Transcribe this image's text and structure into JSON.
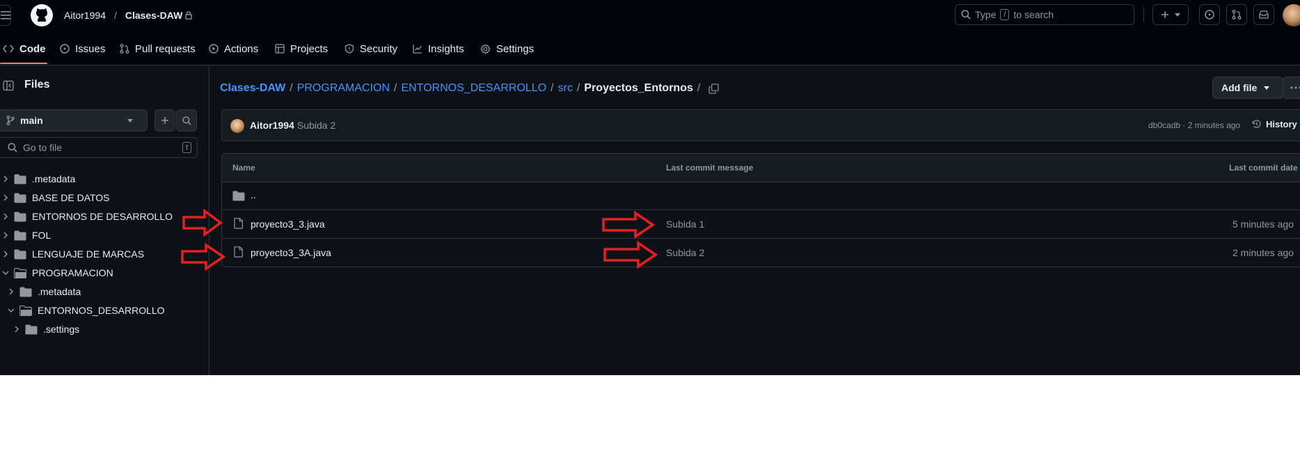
{
  "header": {
    "owner": "Aitor1994",
    "separator": "/",
    "repo": "Clases-DAW",
    "search_prefix": "Type",
    "search_key": "/",
    "search_suffix": "to search",
    "icons": [
      "hamburger-icon",
      "github-logo-icon",
      "lock-icon",
      "search-icon",
      "plus-icon",
      "caret-down-icon",
      "issue-icon",
      "pull-request-icon",
      "inbox-icon",
      "avatar"
    ]
  },
  "tabs": [
    {
      "label": "Code",
      "icon": "code-icon",
      "selected": true
    },
    {
      "label": "Issues",
      "icon": "issue-icon"
    },
    {
      "label": "Pull requests",
      "icon": "pull-request-icon"
    },
    {
      "label": "Actions",
      "icon": "play-icon"
    },
    {
      "label": "Projects",
      "icon": "table-icon"
    },
    {
      "label": "Security",
      "icon": "shield-icon"
    },
    {
      "label": "Insights",
      "icon": "graph-icon"
    },
    {
      "label": "Settings",
      "icon": "gear-icon"
    }
  ],
  "sidebar": {
    "title": "Files",
    "branch": "main",
    "goto_placeholder": "Go to file",
    "goto_shortcut": "t",
    "tree": [
      {
        "label": ".metadata",
        "expanded": false
      },
      {
        "label": "BASE DE DATOS",
        "expanded": false
      },
      {
        "label": "ENTORNOS DE DESARROLLO",
        "expanded": false
      },
      {
        "label": "FOL",
        "expanded": false
      },
      {
        "label": "LENGUAJE DE MARCAS",
        "expanded": false
      },
      {
        "label": "PROGRAMACION",
        "expanded": true
      },
      {
        "label": ".metadata",
        "expanded": false
      },
      {
        "label": "ENTORNOS_DESARROLLO",
        "expanded": true
      },
      {
        "label": ".settings",
        "expanded": false
      }
    ]
  },
  "breadcrumb": {
    "items": [
      "Clases-DAW",
      "PROGRAMACION",
      "ENTORNOS_DESARROLLO",
      "src"
    ],
    "current": "Proyectos_Entornos",
    "separator": "/"
  },
  "actions": {
    "add_file": "Add file"
  },
  "commit": {
    "author": "Aitor1994",
    "message": "Subida 2",
    "sha_time": "db0cadb · 2 minutes ago",
    "history": "History"
  },
  "table": {
    "headers": {
      "name": "Name",
      "message": "Last commit message",
      "date": "Last commit date"
    },
    "parent": "..",
    "rows": [
      {
        "name": "proyecto3_3.java",
        "message": "Subida 1",
        "date": "5 minutes ago"
      },
      {
        "name": "proyecto3_3A.java",
        "message": "Subida 2",
        "date": "2 minutes ago"
      }
    ]
  },
  "colors": {
    "bg": "#0d1117",
    "header_bg": "#010409",
    "border": "#30363d",
    "link": "#4493f8",
    "muted": "#9198a1",
    "annotation_arrow": "#e5201f",
    "tab_underline": "#f78166"
  }
}
